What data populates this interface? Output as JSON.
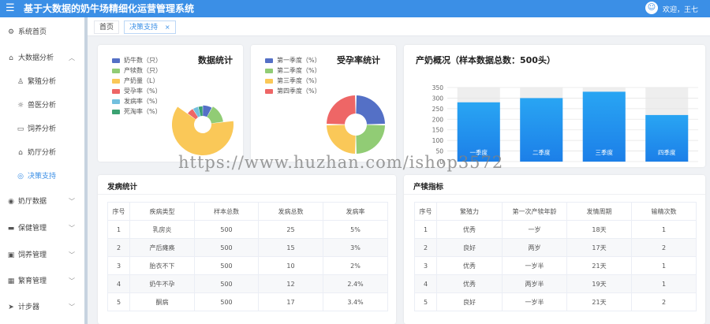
{
  "app": {
    "title": "基于大数据的奶牛场精细化运营管理系统",
    "welcome": "欢迎，王七"
  },
  "sidebar": {
    "items": [
      {
        "label": "系统首页",
        "icon": "gear-icon"
      },
      {
        "label": "大数据分析",
        "icon": "home-icon"
      },
      {
        "label": "繁殖分析",
        "icon": "person-icon"
      },
      {
        "label": "兽医分析",
        "icon": "sun-icon"
      },
      {
        "label": "饲养分析",
        "icon": "screen-icon"
      },
      {
        "label": "奶厅分析",
        "icon": "house-icon"
      },
      {
        "label": "决策支持",
        "icon": "location-icon"
      },
      {
        "label": "奶厅数据",
        "icon": "coin-icon"
      },
      {
        "label": "保健管理",
        "icon": "briefcase-icon"
      },
      {
        "label": "饲养管理",
        "icon": "folder-icon"
      },
      {
        "label": "繁育管理",
        "icon": "grid-icon"
      },
      {
        "label": "计步器",
        "icon": "send-icon"
      }
    ]
  },
  "tabs": [
    {
      "label": "首页"
    },
    {
      "label": "决策支持"
    }
  ],
  "stats_card": {
    "title": "数据统计",
    "legend": [
      {
        "label": "奶牛数（只）",
        "color": "#5470c6",
        "value": 8
      },
      {
        "label": "产犊数（只）",
        "color": "#91cc75",
        "value": 15
      },
      {
        "label": "产奶量（L）",
        "color": "#fac858",
        "value": 62
      },
      {
        "label": "受孕率（%）",
        "color": "#ee6666",
        "value": 6
      },
      {
        "label": "发病率（%）",
        "color": "#73c0de",
        "value": 5
      },
      {
        "label": "死淘率（%）",
        "color": "#3ba272",
        "value": 4
      }
    ]
  },
  "pregnancy_card": {
    "title": "受孕率统计",
    "legend": [
      {
        "label": "第一季度（%）",
        "color": "#5470c6",
        "value": 25
      },
      {
        "label": "第二季度（%）",
        "color": "#91cc75",
        "value": 25
      },
      {
        "label": "第三季度（%）",
        "color": "#fac858",
        "value": 25
      },
      {
        "label": "第四季度（%）",
        "color": "#ee6666",
        "value": 25
      }
    ]
  },
  "chart_data": {
    "type": "bar",
    "title": "产奶概况（样本数据总数：500头）",
    "categories": [
      "一季度",
      "二季度",
      "三季度",
      "四季度"
    ],
    "values": [
      280,
      300,
      330,
      220
    ],
    "ylim": [
      0,
      350
    ],
    "yticks": [
      "0",
      "50",
      "100",
      "150",
      "200",
      "250",
      "300",
      "350"
    ],
    "grid": true
  },
  "disease_table": {
    "title": "发病统计",
    "headers": [
      "序号",
      "疾病类型",
      "样本总数",
      "发病总数",
      "发病率"
    ],
    "rows": [
      [
        "1",
        "乳房炎",
        "500",
        "25",
        "5%"
      ],
      [
        "2",
        "产后瘫痪",
        "500",
        "15",
        "3%"
      ],
      [
        "3",
        "胎衣不下",
        "500",
        "10",
        "2%"
      ],
      [
        "4",
        "奶牛不孕",
        "500",
        "12",
        "2.4%"
      ],
      [
        "5",
        "酮病",
        "500",
        "17",
        "3.4%"
      ]
    ]
  },
  "calving_table": {
    "title": "产犊指标",
    "headers": [
      "序号",
      "繁殖力",
      "第一次产犊年龄",
      "发情周期",
      "输精次数"
    ],
    "rows": [
      [
        "1",
        "优秀",
        "一岁",
        "18天",
        "1"
      ],
      [
        "2",
        "良好",
        "两岁",
        "17天",
        "2"
      ],
      [
        "3",
        "优秀",
        "一岁半",
        "21天",
        "1"
      ],
      [
        "4",
        "优秀",
        "两岁半",
        "19天",
        "1"
      ],
      [
        "5",
        "良好",
        "一岁半",
        "21天",
        "2"
      ]
    ]
  },
  "watermark": "https://www.huzhan.com/ishop3572"
}
